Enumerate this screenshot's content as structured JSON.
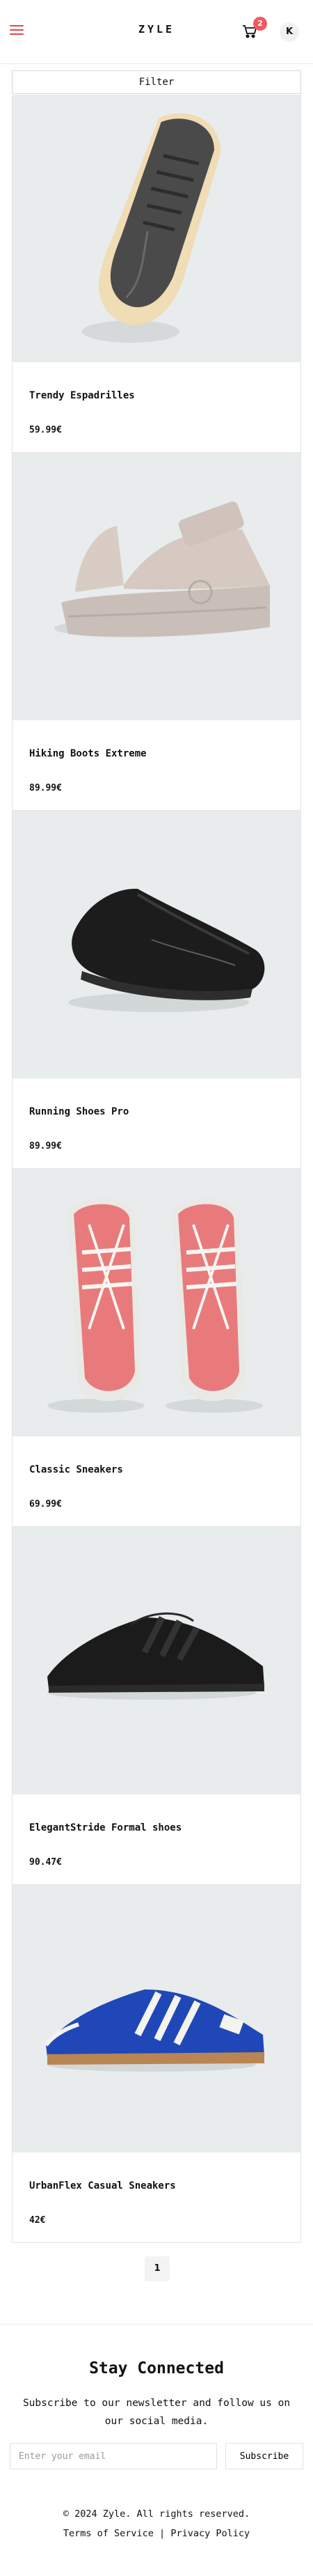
{
  "header": {
    "logo": "ZYLE",
    "cart_count": "2",
    "avatar_initial": "K"
  },
  "filter": {
    "label": "Filter"
  },
  "products": [
    {
      "name": "Trendy Espadrilles",
      "price": "59.99€"
    },
    {
      "name": "Hiking Boots Extreme",
      "price": "89.99€"
    },
    {
      "name": "Running Shoes Pro",
      "price": "89.99€"
    },
    {
      "name": "Classic Sneakers",
      "price": "69.99€"
    },
    {
      "name": "ElegantStride Formal shoes",
      "price": "90.47€"
    },
    {
      "name": "UrbanFlex Casual Sneakers",
      "price": "42€"
    }
  ],
  "pagination": {
    "current": "1"
  },
  "footer": {
    "title": "Stay Connected",
    "text": "Subscribe to our newsletter and follow us on our social media.",
    "email_placeholder": "Enter your email",
    "subscribe_label": "Subscribe",
    "copyright": "© 2024 Zyle. All rights reserved.",
    "terms": "Terms of Service",
    "separator": "|",
    "privacy": "Privacy Policy"
  },
  "colors": {
    "accent": "#e2474b",
    "image_bg": "#e8eced"
  }
}
